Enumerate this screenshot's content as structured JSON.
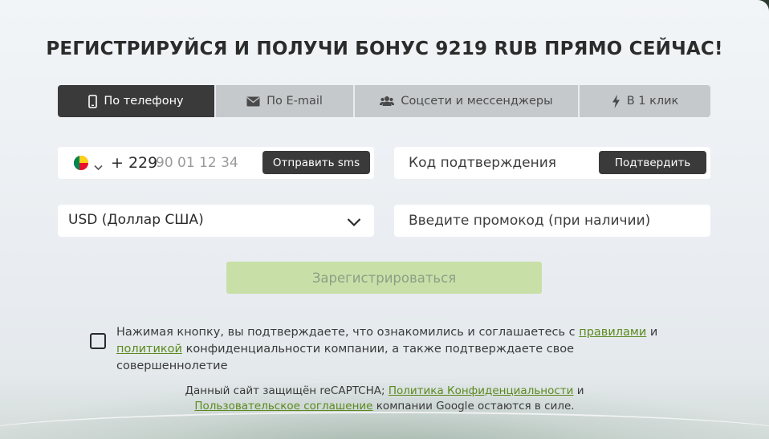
{
  "title": "РЕГИСТРИРУЙСЯ И ПОЛУЧИ БОНУС 9219 RUB ПРЯМО СЕЙЧАС!",
  "tabs": [
    {
      "label": "По телефону",
      "icon": "phone-icon",
      "active": true
    },
    {
      "label": "По E-mail",
      "icon": "envelope-icon",
      "active": false
    },
    {
      "label": "Соцсети и мессенджеры",
      "icon": "users-icon",
      "active": false
    },
    {
      "label": "В 1 клик",
      "icon": "lightning-icon",
      "active": false
    }
  ],
  "phone": {
    "country_flag": "benin-flag-icon",
    "prefix": "+ 229",
    "placeholder": "90 01 12 34",
    "send_sms_label": "Отправить sms"
  },
  "code": {
    "placeholder": "Код подтверждения",
    "confirm_label": "Подтвердить"
  },
  "currency": {
    "selected": "USD (Доллар США)"
  },
  "promo": {
    "placeholder": "Введите промокод (при наличии)"
  },
  "register_label": "Зарегистрироваться",
  "consent": {
    "part1": "Нажимая кнопку, вы подтверждаете, что ознакомились и соглашаетесь с ",
    "rules_link": "правилами",
    "part2": " и ",
    "policy_link": "политикой",
    "part3": " конфиденциальности компании, а также подтверждаете свое совершеннолетие"
  },
  "recaptcha": {
    "part1": "Данный сайт защищён reCAPTCHA; ",
    "privacy_link": "Политика Конфиденциальности",
    "part2": " и ",
    "terms_link": "Пользовательское соглашение",
    "part3": " компании Google остаются в силе."
  },
  "colors": {
    "accent_green": "#5c8a1e",
    "register_bg": "#c8e0a8",
    "dark_button": "#3a3a3a",
    "tab_inactive": "#c6c9cc"
  }
}
